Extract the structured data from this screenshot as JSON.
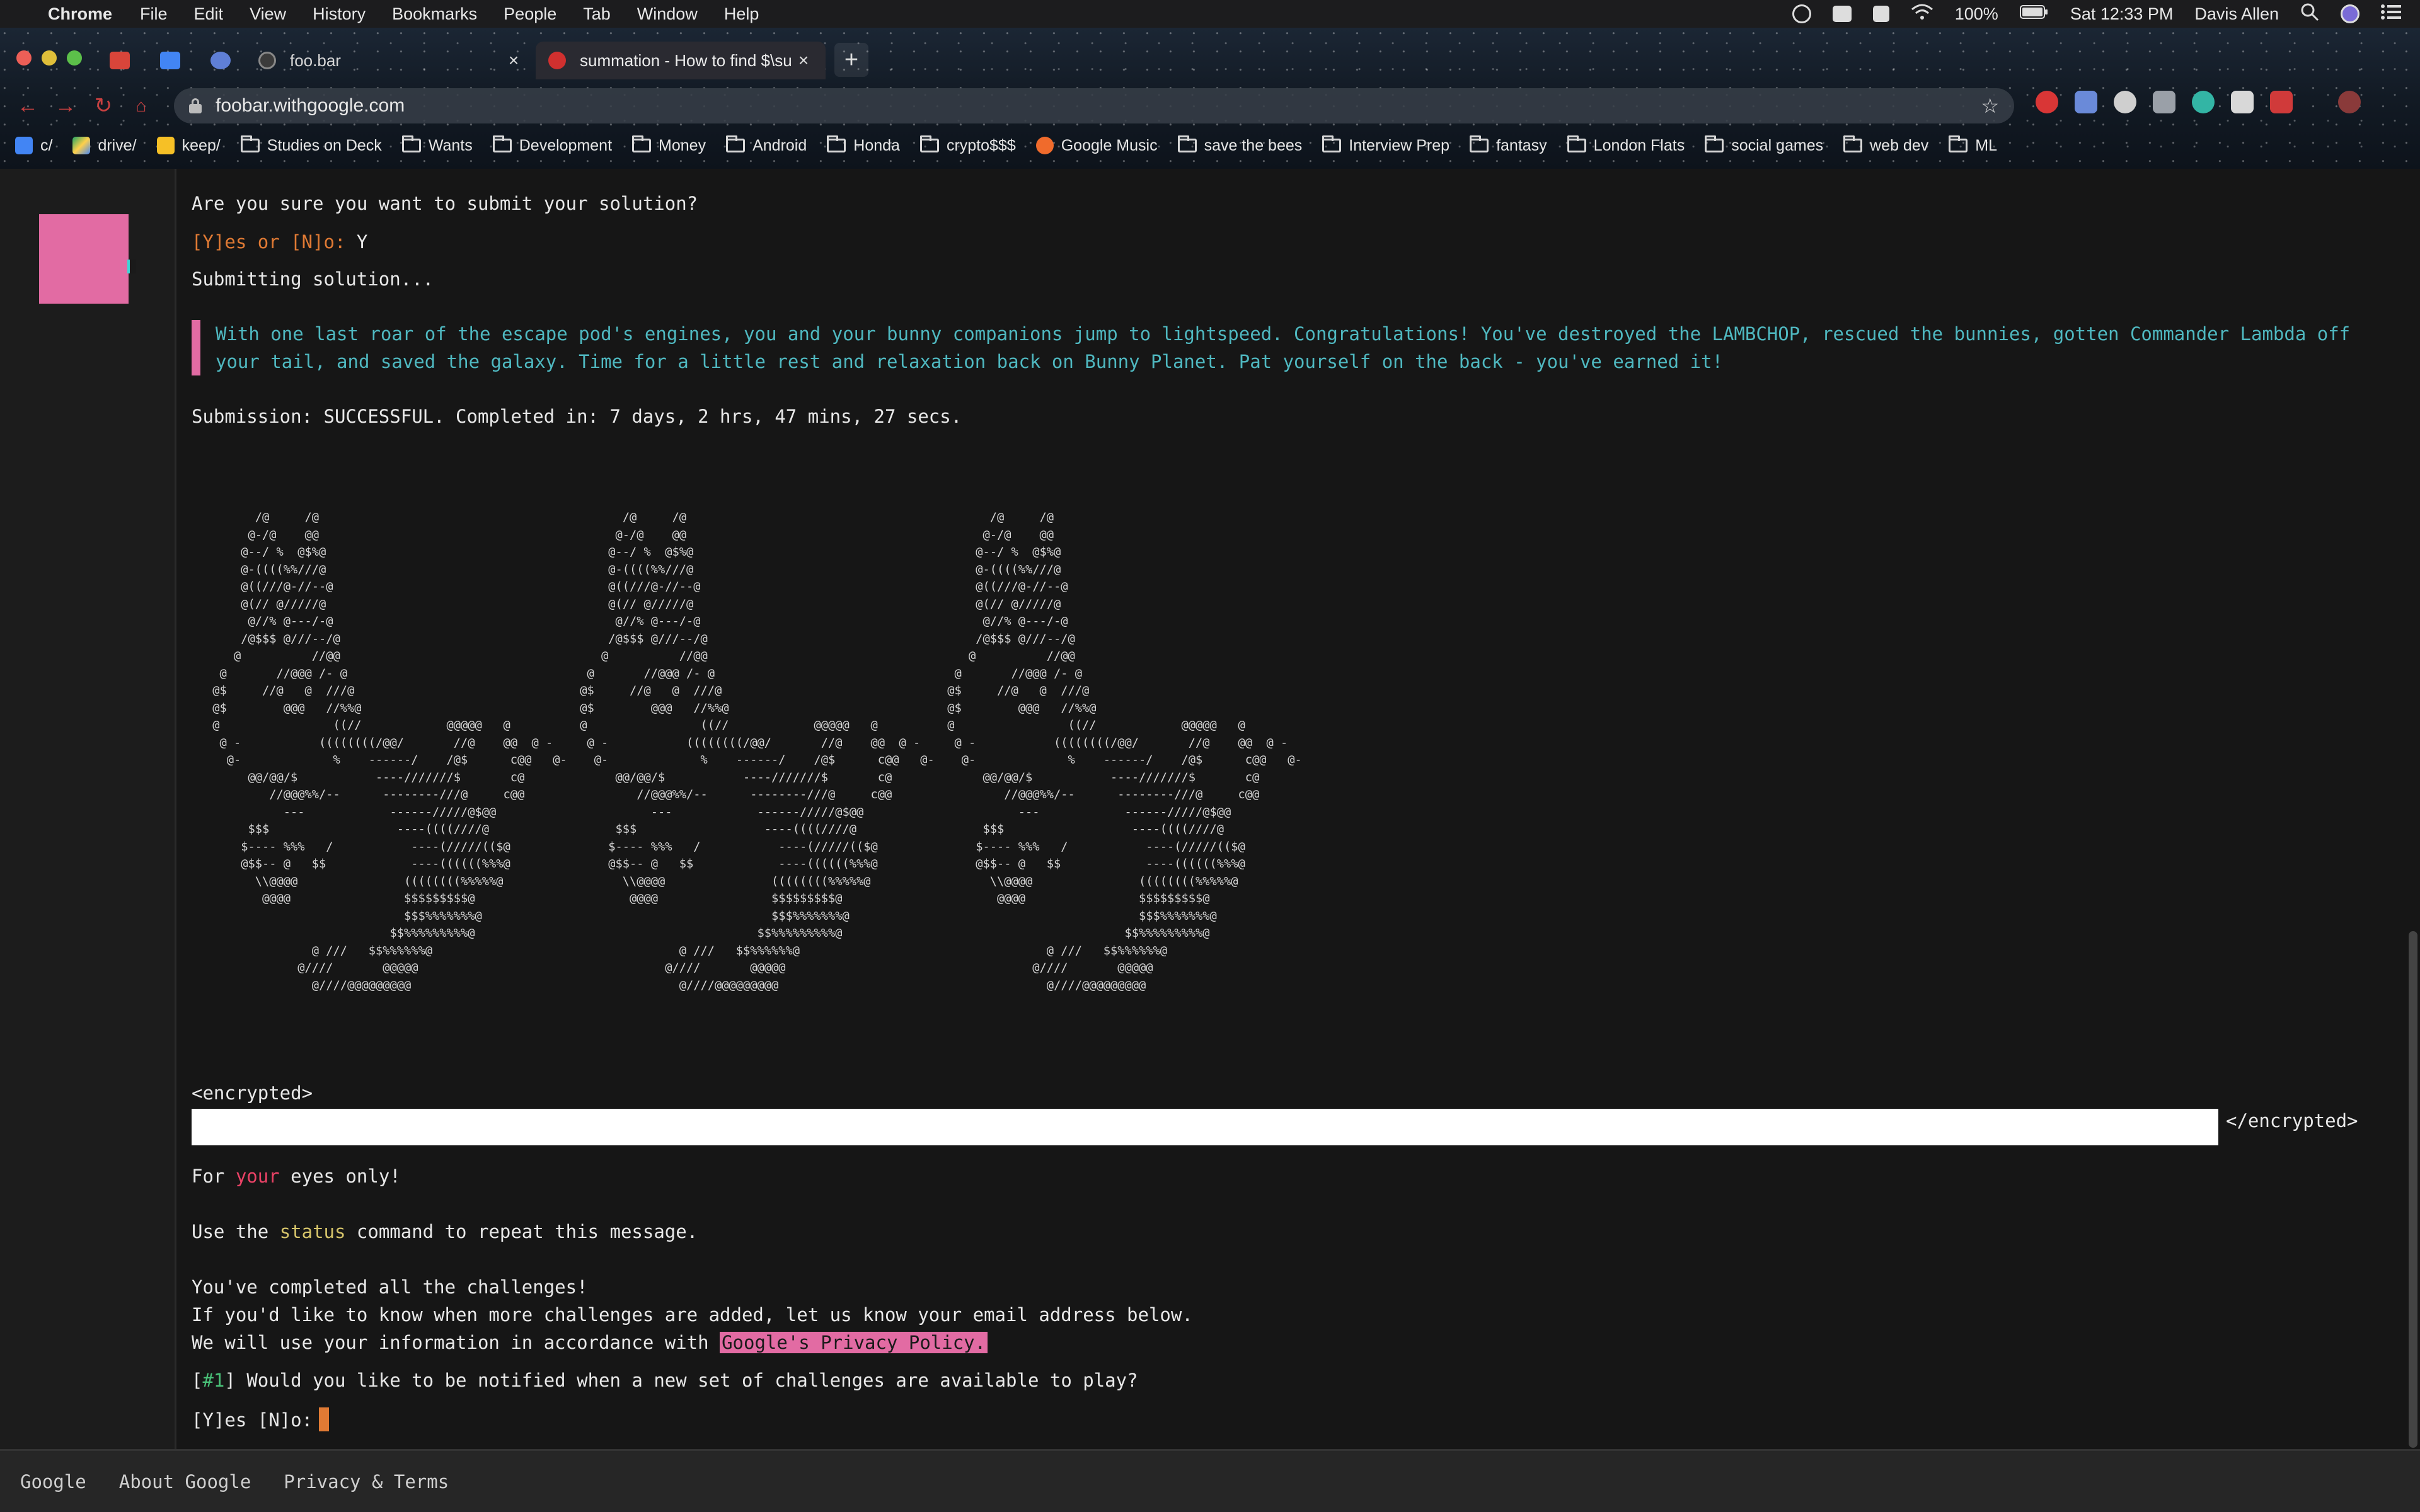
{
  "menubar": {
    "app": "Chrome",
    "items": [
      "File",
      "Edit",
      "View",
      "History",
      "Bookmarks",
      "People",
      "Tab",
      "Window",
      "Help"
    ],
    "battery": "100%",
    "clock": "Sat 12:33 PM",
    "user": "Davis Allen"
  },
  "tabs": [
    {
      "title": "foo.bar",
      "icon": "generic-favicon"
    },
    {
      "title": "summation - How to find $\\su",
      "icon": "stack-exchange-favicon"
    }
  ],
  "url": "foobar.withgoogle.com",
  "bookmarks": [
    "c/",
    "drive/",
    "keep/",
    "Studies on Deck",
    "Wants",
    "Development",
    "Money",
    "Android",
    "Honda",
    "crypto$$$",
    "Google Music",
    "save the bees",
    "Interview Prep",
    "fantasy",
    "London Flats",
    "social games",
    "web dev",
    "ML"
  ],
  "terminal": {
    "confirm_question": "Are you sure you want to submit your solution?",
    "yn_prompt": "[Y]es or [N]o:",
    "yn_answer": " Y",
    "submitting": "Submitting solution...",
    "story": "With one last roar of the escape pod's engines, you and your bunny companions jump to lightspeed. Congratulations! You've destroyed the LAMBCHOP, rescued the bunnies, gotten Commander Lambda off your tail, and saved the galaxy. Time for a little rest and relaxation back on Bunny Planet. Pat yourself on the back - you've earned it!",
    "submission_result": "Submission: SUCCESSFUL. Completed in: 7 days, 2 hrs, 47 mins, 27 secs.",
    "ascii_art": "       /@     /@\n      @-/@    @@\n     @--/ %  @$%@\n     @-((((%%///@\n     @((///@-//--@\n     @(// @/////@\n      @//% @---/-@\n     /@$$$ @///--/@\n    @          //@@\n  @       //@@@ /- @\n @$     //@   @  ///@\n @$        @@@   //%%@\n @                ((//            @@@@@   @\n  @ -           ((((((((/@@/       //@    @@  @ -\n   @-             %    ------/    /@$      c@@   @-\n      @@/@@/$           ----///////$       c@\n         //@@@%%/--      --------///@     c@@\n           ---            ------/////@$@@\n      $$$                  ----((((////@\n     $---- %%%   /           ----(/////(($@\n     @$$-- @   $$            ----((((((%%%@\n       \\\\@@@@               ((((((((%%%%%@\n        @@@@                $$$$$$$$$@\n                            $$$%%%%%%%@\n                          $$%%%%%%%%%@\n               @ ///   $$%%%%%%@\n             @////       @@@@@\n               @////@@@@@@@@@",
    "encrypted_open": "<encrypted>",
    "encrypted_close": "</encrypted>",
    "eyes_pre": "For ",
    "eyes_your": "your",
    "eyes_post": " eyes only!",
    "status_pre": "Use the ",
    "status_cmd": "status",
    "status_post": " command to repeat this message.",
    "completed": "You've completed all the challenges!",
    "email_line": "If you'd like to know when more challenges are added, let us know your email address below.",
    "privacy_pre": "We will use your information in accordance with ",
    "privacy_link": "Google's Privacy Policy.",
    "q_open": "[",
    "q_num": "#1",
    "q_close": "]",
    "question": " Would you like to be notified when a new set of challenges are available to play?",
    "final_prompt": "[Y]es [N]o:"
  },
  "footer": {
    "links": [
      "Google",
      "About Google",
      "Privacy & Terms"
    ]
  }
}
